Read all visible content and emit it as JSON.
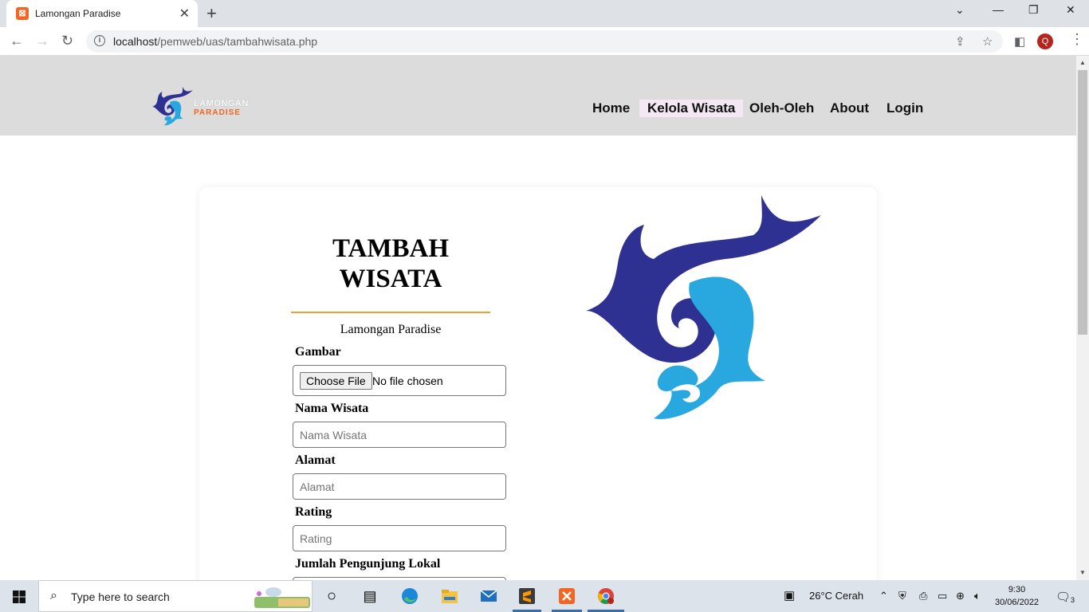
{
  "browser": {
    "tab_title": "Lamongan Paradise",
    "url_host": "localhost",
    "url_path": "/pemweb/uas/tambahwisata.php",
    "profile_initial": "Q"
  },
  "site": {
    "brand_line1": "LAMONGAN",
    "brand_line2": "PARADISE",
    "nav": [
      "Home",
      "Kelola Wisata",
      "Oleh-Oleh",
      "About",
      "Login"
    ],
    "active_nav": "Kelola Wisata"
  },
  "form": {
    "title": "TAMBAH WISATA",
    "subtitle": "Lamongan Paradise",
    "fields": {
      "gambar": {
        "label": "Gambar",
        "button": "Choose File",
        "status": "No file chosen"
      },
      "nama": {
        "label": "Nama Wisata",
        "placeholder": "Nama Wisata"
      },
      "alamat": {
        "label": "Alamat",
        "placeholder": "Alamat"
      },
      "rating": {
        "label": "Rating",
        "placeholder": "Rating"
      },
      "lokal": {
        "label": "Jumlah Pengunjung Lokal",
        "placeholder": ""
      }
    }
  },
  "taskbar": {
    "search_placeholder": "Type here to search",
    "weather": "26°C  Cerah",
    "time": "9:30",
    "date": "30/06/2022",
    "notification_count": "3"
  },
  "colors": {
    "header_bg": "#dcdcdc",
    "accent_rule": "#f0a030",
    "logo_dark": "#2e3192",
    "logo_light": "#29a8e0",
    "brand_orange": "#f26522"
  }
}
